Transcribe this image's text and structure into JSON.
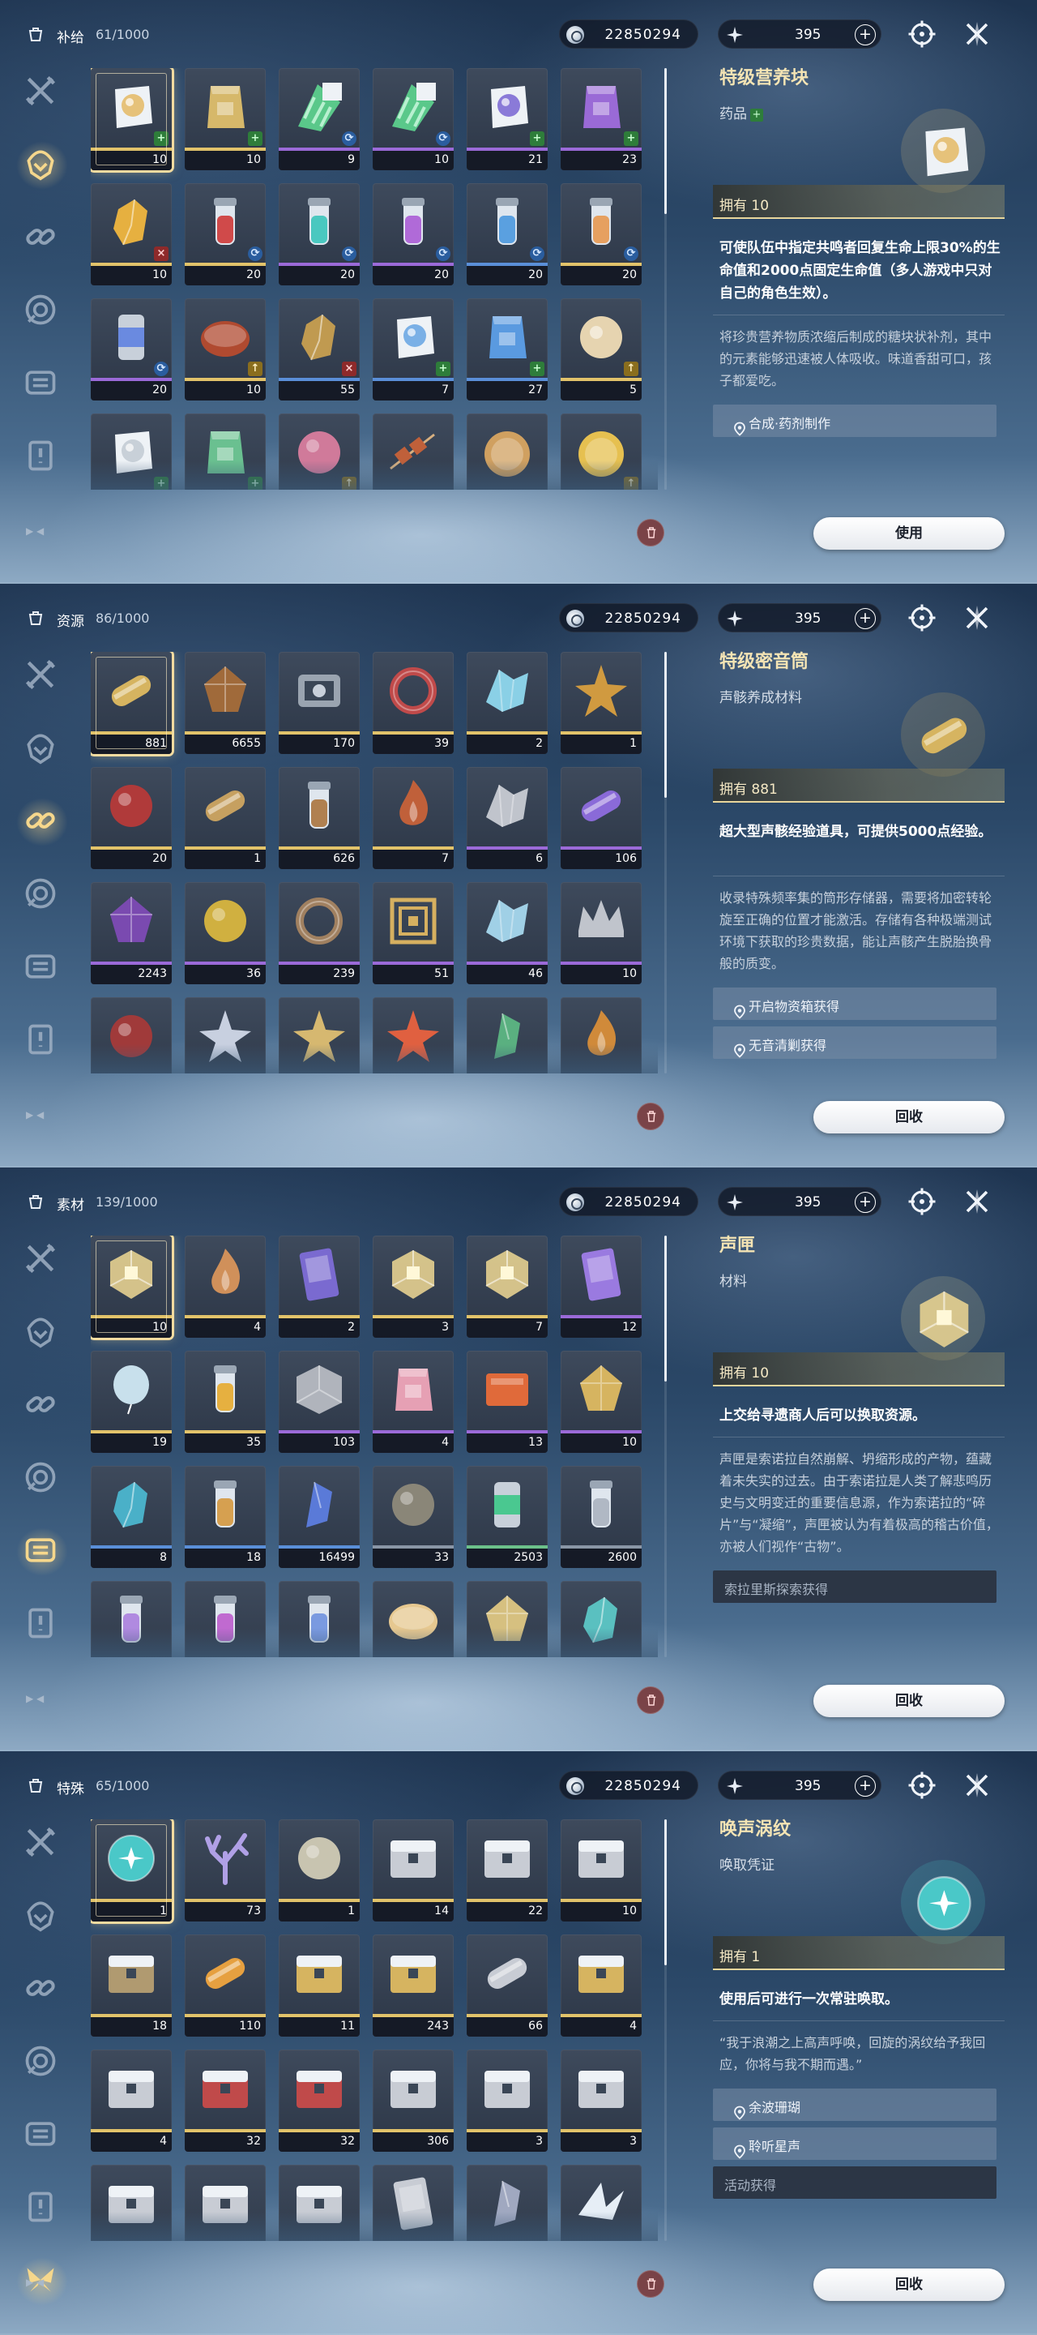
{
  "panels": [
    {
      "category": "补给",
      "count": "61/1000",
      "currency": "22850294",
      "energy": "395",
      "active_tab": 2,
      "items": [
        {
          "qty": "10",
          "q": "gold",
          "badge": "plus",
          "art": "pack",
          "c": "#e6c27a"
        },
        {
          "qty": "10",
          "q": "gold",
          "badge": "plus",
          "art": "bag",
          "c": "#d6b86a"
        },
        {
          "qty": "9",
          "q": "purple",
          "badge": "cycle",
          "art": "strip",
          "c": "#5ac88a"
        },
        {
          "qty": "10",
          "q": "purple",
          "badge": "cycle",
          "art": "strip",
          "c": "#5ac88a"
        },
        {
          "qty": "21",
          "q": "purple",
          "badge": "plus",
          "art": "pack",
          "c": "#8a7ad8"
        },
        {
          "qty": "23",
          "q": "purple",
          "badge": "plus",
          "art": "bag",
          "c": "#9a6ad6"
        },
        {
          "qty": "10",
          "q": "gold",
          "badge": "x",
          "art": "crystal",
          "c": "#e6b040"
        },
        {
          "qty": "20",
          "q": "gold",
          "badge": "cycle",
          "art": "vial",
          "c": "#d04a4a"
        },
        {
          "qty": "20",
          "q": "purple",
          "badge": "cycle",
          "art": "vial",
          "c": "#4ac8c0"
        },
        {
          "qty": "20",
          "q": "purple",
          "badge": "cycle",
          "art": "vial",
          "c": "#b06ad8"
        },
        {
          "qty": "20",
          "q": "blue",
          "badge": "cycle",
          "art": "vial",
          "c": "#5aa0e0"
        },
        {
          "qty": "20",
          "q": "gold",
          "badge": "cycle",
          "art": "vial",
          "c": "#e6a060"
        },
        {
          "qty": "20",
          "q": "purple",
          "badge": "cycle",
          "art": "can",
          "c": "#6a8ae0"
        },
        {
          "qty": "10",
          "q": "gold",
          "badge": "up",
          "art": "bowl",
          "c": "#b04a30"
        },
        {
          "qty": "55",
          "q": "blue",
          "badge": "x",
          "art": "crystal",
          "c": "#c09a50"
        },
        {
          "qty": "7",
          "q": "blue",
          "badge": "plus",
          "art": "pack",
          "c": "#7ab0e6"
        },
        {
          "qty": "27",
          "q": "blue",
          "badge": "plus",
          "art": "bag",
          "c": "#5a9ae0"
        },
        {
          "qty": "5",
          "q": "gold",
          "badge": "up",
          "art": "bun",
          "c": "#e6d4b0"
        },
        {
          "qty": "",
          "q": "gray",
          "badge": "plus",
          "art": "pack",
          "c": "#c8d0d8"
        },
        {
          "qty": "",
          "q": "gray",
          "badge": "plus",
          "art": "bag",
          "c": "#6ac090"
        },
        {
          "qty": "",
          "q": "gray",
          "badge": "up",
          "art": "orb",
          "c": "#d07a9a"
        },
        {
          "qty": "",
          "q": "gray",
          "badge": "",
          "art": "skewer",
          "c": "#c0603a"
        },
        {
          "qty": "",
          "q": "gray",
          "badge": "",
          "art": "pie",
          "c": "#d0a060"
        },
        {
          "qty": "",
          "q": "gray",
          "badge": "up",
          "art": "pie",
          "c": "#e6c050"
        }
      ],
      "detail": {
        "title": "特级营养块",
        "type": "药品",
        "type_plus": "+",
        "owned": "拥有 10",
        "effect": "可使队伍中指定共鸣者回复生命上限30%的生命值和2000点固定生命值（多人游戏中只对自己的角色生效）。",
        "desc": "将珍贵营养物质浓缩后制成的糖块状补剂，其中的元素能够迅速被人体吸收。味道香甜可口，孩子都爱吃。",
        "sources": [
          {
            "text": "合成·药剂制作",
            "dark": false
          }
        ],
        "button": "使用",
        "art_color": "#e6c27a"
      }
    },
    {
      "category": "资源",
      "count": "86/1000",
      "currency": "22850294",
      "energy": "395",
      "active_tab": 3,
      "items": [
        {
          "qty": "881",
          "q": "gold",
          "badge": "",
          "art": "capsule",
          "c": "#d6b460"
        },
        {
          "qty": "6655",
          "q": "gold",
          "badge": "",
          "art": "gem",
          "c": "#a06a3a"
        },
        {
          "qty": "170",
          "q": "gold",
          "badge": "",
          "art": "device",
          "c": "#9aa4b0"
        },
        {
          "qty": "39",
          "q": "gold",
          "badge": "",
          "art": "ring",
          "c": "#c04a4a"
        },
        {
          "qty": "2",
          "q": "gold",
          "badge": "",
          "art": "shell",
          "c": "#8ad0e6"
        },
        {
          "qty": "1",
          "q": "gold",
          "badge": "",
          "art": "star",
          "c": "#d09a40"
        },
        {
          "qty": "20",
          "q": "gold",
          "badge": "",
          "art": "orb",
          "c": "#b03a3a"
        },
        {
          "qty": "1",
          "q": "gold",
          "badge": "",
          "art": "capsule",
          "c": "#c6a060"
        },
        {
          "qty": "626",
          "q": "gold",
          "badge": "",
          "art": "vial",
          "c": "#b08050"
        },
        {
          "qty": "7",
          "q": "gold",
          "badge": "",
          "art": "flame",
          "c": "#c0603a"
        },
        {
          "qty": "6",
          "q": "purple",
          "badge": "",
          "art": "shell",
          "c": "#c0c4cc"
        },
        {
          "qty": "106",
          "q": "purple",
          "badge": "",
          "art": "capsule",
          "c": "#8a6ad8"
        },
        {
          "qty": "2243",
          "q": "purple",
          "badge": "",
          "art": "gem",
          "c": "#7a4ab0"
        },
        {
          "qty": "36",
          "q": "purple",
          "badge": "",
          "art": "orb",
          "c": "#d0b040"
        },
        {
          "qty": "239",
          "q": "purple",
          "badge": "",
          "art": "ring",
          "c": "#a08060"
        },
        {
          "qty": "51",
          "q": "purple",
          "badge": "",
          "art": "maze",
          "c": "#d6b060"
        },
        {
          "qty": "46",
          "q": "purple",
          "badge": "",
          "art": "shell",
          "c": "#a0d0e6"
        },
        {
          "qty": "10",
          "q": "purple",
          "badge": "",
          "art": "crown",
          "c": "#c0c4cc"
        },
        {
          "qty": "",
          "q": "gray",
          "badge": "",
          "art": "orb",
          "c": "#a03a3a"
        },
        {
          "qty": "",
          "q": "gray",
          "badge": "",
          "art": "star",
          "c": "#c8d0e0"
        },
        {
          "qty": "",
          "q": "gray",
          "badge": "",
          "art": "star",
          "c": "#d6b870"
        },
        {
          "qty": "",
          "q": "gray",
          "badge": "",
          "art": "star",
          "c": "#e06040"
        },
        {
          "qty": "",
          "q": "gray",
          "badge": "",
          "art": "shard",
          "c": "#5ab080"
        },
        {
          "qty": "",
          "q": "gray",
          "badge": "",
          "art": "flame",
          "c": "#d08a3a"
        }
      ],
      "detail": {
        "title": "特级密音筒",
        "type": "声骸养成材料",
        "type_plus": "",
        "owned": "拥有 881",
        "effect": "超大型声骸经验道具，可提供5000点经验。",
        "desc": "收录特殊频率集的筒形存储器，需要将加密转轮旋至正确的位置才能激活。存储有各种极端测试环境下获取的珍贵数据，能让声骸产生脱胎换骨般的质变。",
        "sources": [
          {
            "text": "开启物资箱获得",
            "dark": false
          },
          {
            "text": "无音清剿获得",
            "dark": false
          }
        ],
        "button": "回收",
        "art_color": "#d6b460"
      }
    },
    {
      "category": "素材",
      "count": "139/1000",
      "currency": "22850294",
      "energy": "395",
      "active_tab": 5,
      "items": [
        {
          "qty": "10",
          "q": "gold",
          "badge": "",
          "art": "cube",
          "c": "#e6d090"
        },
        {
          "qty": "4",
          "q": "gold",
          "badge": "",
          "art": "flame",
          "c": "#d0905a"
        },
        {
          "qty": "2",
          "q": "gold",
          "badge": "",
          "art": "card",
          "c": "#7a6ad0"
        },
        {
          "qty": "3",
          "q": "gold",
          "badge": "",
          "art": "cube",
          "c": "#e6d090"
        },
        {
          "qty": "7",
          "q": "gold",
          "badge": "",
          "art": "cube",
          "c": "#e6d090"
        },
        {
          "qty": "12",
          "q": "purple",
          "badge": "",
          "art": "card",
          "c": "#9a7ae0"
        },
        {
          "qty": "19",
          "q": "gold",
          "badge": "",
          "art": "balloon",
          "c": "#c8e0ec"
        },
        {
          "qty": "35",
          "q": "gold",
          "badge": "",
          "art": "vial",
          "c": "#e6b040"
        },
        {
          "qty": "103",
          "q": "purple",
          "badge": "",
          "art": "box",
          "c": "#b0b4bc"
        },
        {
          "qty": "4",
          "q": "purple",
          "badge": "",
          "art": "bag",
          "c": "#e6a0b4"
        },
        {
          "qty": "13",
          "q": "purple",
          "badge": "",
          "art": "book",
          "c": "#e06a3a"
        },
        {
          "qty": "10",
          "q": "purple",
          "badge": "",
          "art": "gem",
          "c": "#d6b460"
        },
        {
          "qty": "8",
          "q": "blue",
          "badge": "",
          "art": "crystal",
          "c": "#4ab0c8"
        },
        {
          "qty": "18",
          "q": "blue",
          "badge": "",
          "art": "vial",
          "c": "#d6a050"
        },
        {
          "qty": "16499",
          "q": "blue",
          "badge": "",
          "art": "shard",
          "c": "#5a7ad8"
        },
        {
          "qty": "33",
          "q": "gray",
          "badge": "",
          "art": "orb",
          "c": "#8a8678"
        },
        {
          "qty": "2503",
          "q": "green",
          "badge": "",
          "art": "can",
          "c": "#4ac890"
        },
        {
          "qty": "2600",
          "q": "gray",
          "badge": "",
          "art": "vial",
          "c": "#b0b8c4"
        },
        {
          "qty": "",
          "q": "gray",
          "badge": "",
          "art": "vial",
          "c": "#b08ae0"
        },
        {
          "qty": "",
          "q": "gray",
          "badge": "",
          "art": "vial",
          "c": "#c06ad0"
        },
        {
          "qty": "",
          "q": "gray",
          "badge": "",
          "art": "vial",
          "c": "#7a9ae0"
        },
        {
          "qty": "",
          "q": "gray",
          "badge": "",
          "art": "bowl",
          "c": "#e6c890"
        },
        {
          "qty": "",
          "q": "gray",
          "badge": "",
          "art": "gem",
          "c": "#d6c080"
        },
        {
          "qty": "",
          "q": "gray",
          "badge": "",
          "art": "crystal",
          "c": "#5ac0c0"
        }
      ],
      "detail": {
        "title": "声匣",
        "type": "材料",
        "type_plus": "",
        "owned": "拥有 10",
        "effect": "上交给寻遗商人后可以换取资源。",
        "desc": "声匣是索诺拉自然崩解、坍缩形成的产物，蕴藏着未失实的过去。由于索诺拉是人类了解悲鸣历史与文明变迁的重要信息源，作为索诺拉的“碎片”与“凝缩”，声匣被认为有着极高的稽古价值，亦被人们视作“古物”。",
        "sources": [
          {
            "text": "索拉里斯探索获得",
            "dark": true
          }
        ],
        "button": "回收",
        "art_color": "#e6d090"
      }
    },
    {
      "category": "特殊",
      "count": "65/1000",
      "currency": "22850294",
      "energy": "395",
      "active_tab": 7,
      "items": [
        {
          "qty": "1",
          "q": "gold",
          "badge": "",
          "art": "sphere",
          "c": "#4ac8c8"
        },
        {
          "qty": "73",
          "q": "gold",
          "badge": "",
          "art": "coral",
          "c": "#b0a0e6"
        },
        {
          "qty": "1",
          "q": "gold",
          "badge": "",
          "art": "orb",
          "c": "#c8c4b0"
        },
        {
          "qty": "14",
          "q": "gold",
          "badge": "",
          "art": "chest",
          "c": "#c8ccd4"
        },
        {
          "qty": "22",
          "q": "gold",
          "badge": "",
          "art": "chest",
          "c": "#c8ccd4"
        },
        {
          "qty": "10",
          "q": "gold",
          "badge": "",
          "art": "chest",
          "c": "#c8ccd4"
        },
        {
          "qty": "18",
          "q": "gold",
          "badge": "",
          "art": "chest",
          "c": "#b09a70"
        },
        {
          "qty": "110",
          "q": "gold",
          "badge": "",
          "art": "capsule",
          "c": "#e6a040"
        },
        {
          "qty": "11",
          "q": "gold",
          "badge": "",
          "art": "chest",
          "c": "#d6b460"
        },
        {
          "qty": "243",
          "q": "gold",
          "badge": "",
          "art": "chest",
          "c": "#d6b460"
        },
        {
          "qty": "66",
          "q": "gold",
          "badge": "",
          "art": "capsule",
          "c": "#c8ccd4"
        },
        {
          "qty": "4",
          "q": "gold",
          "badge": "",
          "art": "chest",
          "c": "#d6b460"
        },
        {
          "qty": "4",
          "q": "gold",
          "badge": "",
          "art": "chest",
          "c": "#c8ccd4"
        },
        {
          "qty": "32",
          "q": "gold",
          "badge": "",
          "art": "chest",
          "c": "#c04a4a"
        },
        {
          "qty": "32",
          "q": "gold",
          "badge": "",
          "art": "chest",
          "c": "#c04a4a"
        },
        {
          "qty": "306",
          "q": "gold",
          "badge": "",
          "art": "chest",
          "c": "#c8ccd4"
        },
        {
          "qty": "3",
          "q": "gold",
          "badge": "",
          "art": "chest",
          "c": "#c8ccd4"
        },
        {
          "qty": "3",
          "q": "gold",
          "badge": "",
          "art": "chest",
          "c": "#c8ccd4"
        },
        {
          "qty": "",
          "q": "gray",
          "badge": "",
          "art": "chest",
          "c": "#c8ccd4"
        },
        {
          "qty": "",
          "q": "gray",
          "badge": "",
          "art": "chest",
          "c": "#c8ccd4"
        },
        {
          "qty": "",
          "q": "gray",
          "badge": "",
          "art": "chest",
          "c": "#c8ccd4"
        },
        {
          "qty": "",
          "q": "gray",
          "badge": "",
          "art": "card",
          "c": "#c8ccd4"
        },
        {
          "qty": "",
          "q": "gray",
          "badge": "",
          "art": "shard",
          "c": "#a0a8c0"
        },
        {
          "qty": "",
          "q": "gray",
          "badge": "",
          "art": "crane",
          "c": "#e6eef6"
        }
      ],
      "detail": {
        "title": "唤声涡纹",
        "type": "唤取凭证",
        "type_plus": "",
        "owned": "拥有 1",
        "effect": "使用后可进行一次常驻唤取。",
        "desc": "“我于浪潮之上高声呼唤，回旋的涡纹给予我回应，你将与我不期而遇。”",
        "sources": [
          {
            "text": "余波珊瑚",
            "dark": false
          },
          {
            "text": "聆听星声",
            "dark": false
          },
          {
            "text": "活动获得",
            "dark": true
          }
        ],
        "button": "回收",
        "art_color": "#4ac8c8"
      }
    }
  ]
}
